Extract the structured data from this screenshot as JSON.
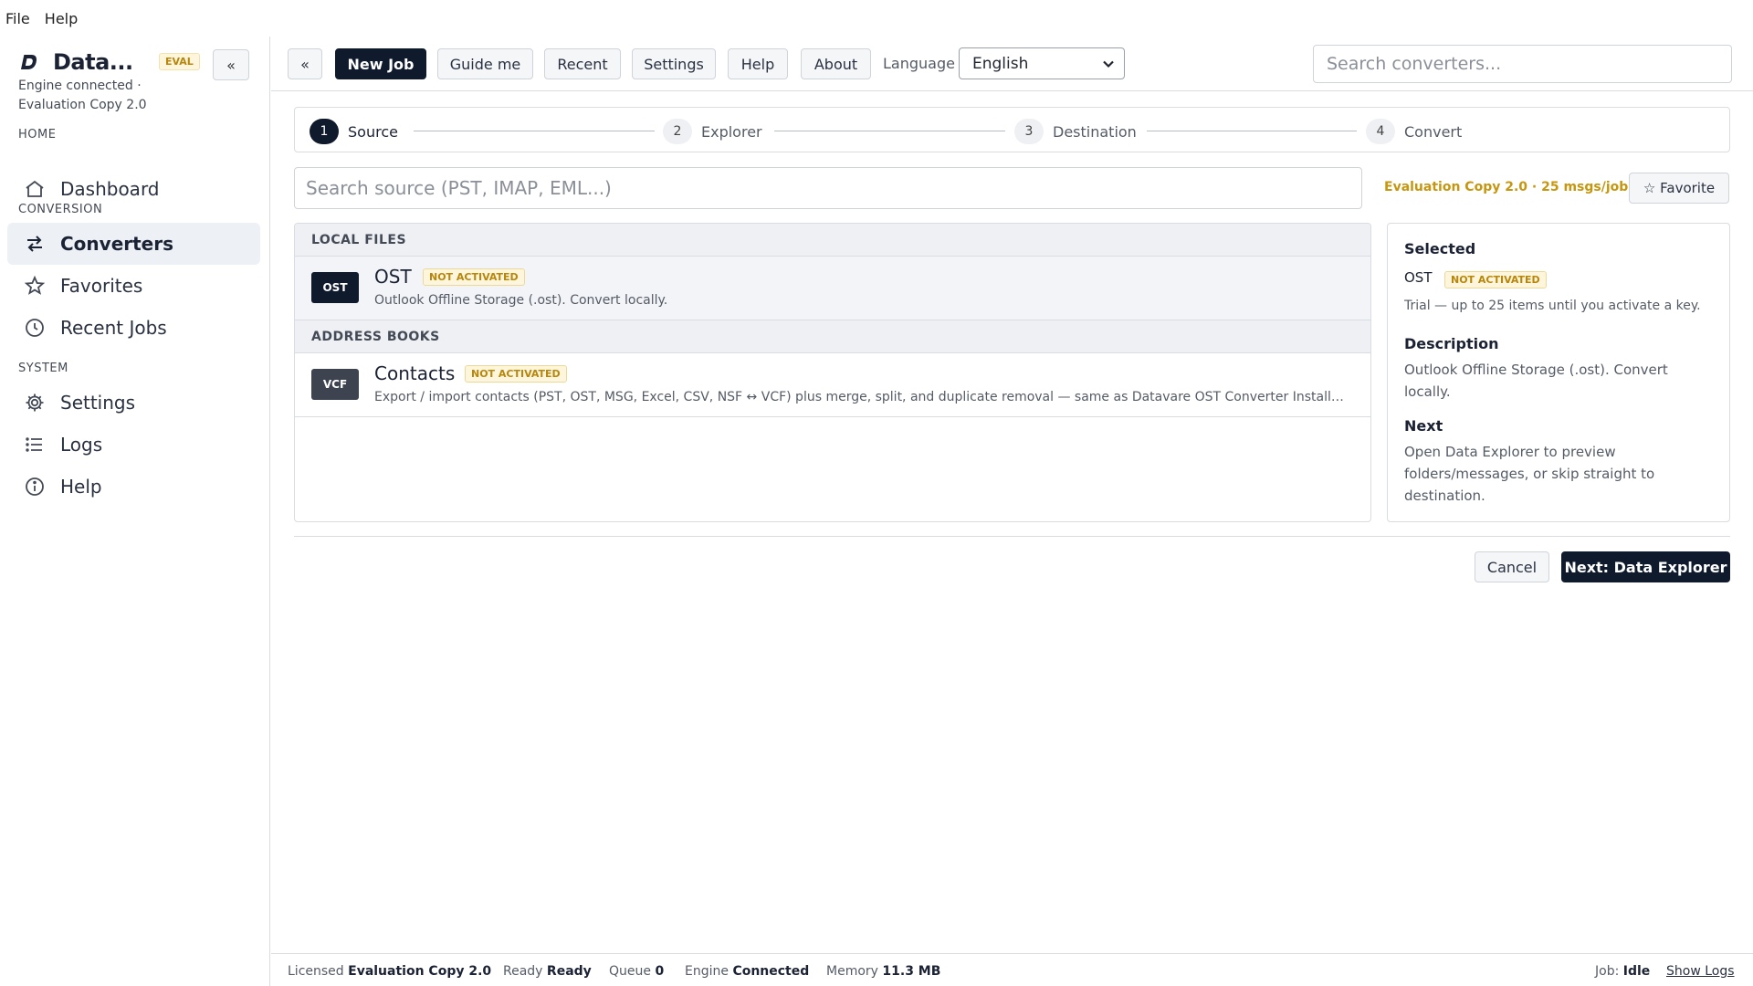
{
  "menubar": {
    "file": "File",
    "help": "Help"
  },
  "sidebar": {
    "title": "Data...",
    "eval_badge": "EVAL",
    "collapse_label": "«",
    "engine_status": "Engine connected · Evaluation Copy 2.0",
    "sections": {
      "home": "HOME",
      "conversion": "CONVERSION",
      "system": "SYSTEM"
    },
    "items": {
      "dashboard": "Dashboard",
      "converters": "Converters",
      "favorites": "Favorites",
      "recent_jobs": "Recent Jobs",
      "settings": "Settings",
      "logs": "Logs",
      "help": "Help"
    }
  },
  "toolbar": {
    "back": "«",
    "new_job": "New Job",
    "guide_me": "Guide me",
    "recent": "Recent",
    "settings": "Settings",
    "help": "Help",
    "about": "About",
    "language_label": "Language",
    "language_value": "English",
    "search_placeholder": "Search converters..."
  },
  "stepper": {
    "steps": [
      {
        "num": "1",
        "label": "Source"
      },
      {
        "num": "2",
        "label": "Explorer"
      },
      {
        "num": "3",
        "label": "Destination"
      },
      {
        "num": "4",
        "label": "Convert"
      }
    ],
    "active_step": 1
  },
  "source": {
    "search_placeholder": "Search source (PST, IMAP, EML...)",
    "eval_note": "Evaluation Copy 2.0 · 25 msgs/job",
    "favorite_label": "☆ Favorite"
  },
  "converter_list": {
    "groups": [
      {
        "header": "LOCAL FILES",
        "items": [
          {
            "icon": "OST",
            "name": "OST",
            "badge": "NOT ACTIVATED",
            "desc": "Outlook Offline Storage (.ost). Convert locally."
          }
        ]
      },
      {
        "header": "ADDRESS BOOKS",
        "items": [
          {
            "icon": "VCF",
            "name": "Contacts",
            "badge": "NOT ACTIVATED",
            "desc": "Export / import contacts (PST, OST, MSG, Excel, CSV, NSF ↔ VCF) plus merge, split, and duplicate removal — same as Datavare OST Converter InstallPro..."
          }
        ]
      }
    ]
  },
  "details": {
    "selected_heading": "Selected",
    "selected_name": "OST",
    "selected_badge": "NOT ACTIVATED",
    "trial_text": "Trial — up to 25 items until you activate a key.",
    "description_heading": "Description",
    "description_text": "Outlook Offline Storage (.ost). Convert locally.",
    "next_heading": "Next",
    "next_text": "Open Data Explorer to preview folders/messages, or skip straight to destination."
  },
  "actions": {
    "cancel": "Cancel",
    "next": "Next: Data Explorer"
  },
  "statusbar": {
    "licensed_label": "Licensed",
    "licensed_value": "Evaluation Copy 2.0",
    "ready_label": "Ready",
    "ready_value": "Ready",
    "queue_label": "Queue",
    "queue_value": "0",
    "engine_label": "Engine",
    "engine_value": "Connected",
    "memory_label": "Memory",
    "memory_value": "11.3 MB",
    "job_label": "Job:",
    "job_value": "Idle",
    "show_logs": "Show Logs"
  },
  "colors": {
    "primary": "#0f1b2d",
    "accent_gold": "#c6960f",
    "border": "#d9dce2"
  }
}
